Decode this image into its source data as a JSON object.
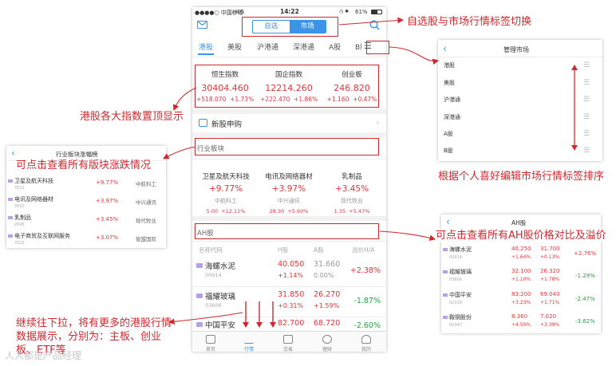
{
  "status_bar": {
    "carrier": "●●●●○ 中国移动",
    "network": "4G",
    "time": "14:22",
    "battery": "61%"
  },
  "segment": {
    "left": "自选",
    "right": "市场",
    "active": "市场"
  },
  "market_tabs": [
    "港股",
    "美股",
    "沪港通",
    "深港通",
    "A股",
    "B股"
  ],
  "active_market_tab": "港股",
  "indices": [
    {
      "name": "恒生指数",
      "value": "30404.460",
      "change": "+518.070",
      "pct": "+1.73%"
    },
    {
      "name": "国企指数",
      "value": "12214.260",
      "change": "+222.470",
      "pct": "+1.86%"
    },
    {
      "name": "创业板",
      "value": "246.820",
      "change": "+1.160",
      "pct": "+0.47%"
    }
  ],
  "ipo_label": "新股申购",
  "sector_title": "行业板块",
  "sectors": [
    {
      "name": "卫星及航天科技",
      "pct": "+9.77%",
      "leader": "中航科工",
      "price": "5.00",
      "leader_pct": "+12.11%"
    },
    {
      "name": "电讯及网络器材",
      "pct": "+3.97%",
      "leader": "中兴通讯",
      "price": "28.30",
      "leader_pct": "+5.60%"
    },
    {
      "name": "乳制品",
      "pct": "+3.45%",
      "leader": "现代牧业",
      "price": "1.35",
      "leader_pct": "+5.47%"
    }
  ],
  "ah_section": {
    "title": "AH股",
    "headers": [
      "名称代码",
      "H股",
      "A股",
      "溢价H/A"
    ],
    "rows": [
      {
        "name": "海螺水泥",
        "code": "00914",
        "h": "40.050",
        "h_chg": "+1.14%",
        "a": "31.660",
        "a_chg": "0.00%",
        "premium": "+2.38%"
      },
      {
        "name": "福耀玻璃",
        "code": "03606",
        "h": "31.850",
        "h_chg": "+0.31%",
        "a": "26.270",
        "a_chg": "+1.59%",
        "premium": "-1.87%"
      },
      {
        "name": "中国平安",
        "code": "02318",
        "h": "82.700",
        "h_chg": "",
        "a": "68.720",
        "a_chg": "",
        "premium": "-2.60%"
      }
    ]
  },
  "bottom_nav": [
    "首页",
    "行情",
    "交易",
    "理财",
    "我的"
  ],
  "active_bottom": "行情",
  "manage_panel": {
    "title": "管理市场",
    "items": [
      "港股",
      "美股",
      "沪港通",
      "深港通",
      "A股",
      "B股"
    ]
  },
  "sector_panel": {
    "title": "行业板块涨幅榜",
    "rows": [
      {
        "name": "卫星及航天科技",
        "code": "7012",
        "pct": "+9.77%",
        "leader": "中航科工"
      },
      {
        "name": "电讯及网络器材",
        "code": "3502",
        "pct": "+3.97%",
        "leader": "中兴通讯"
      },
      {
        "name": "乳制品",
        "code": "2045",
        "pct": "+3.45%",
        "leader": "现代牧业"
      },
      {
        "name": "电子商贸及互联网服务",
        "code": "7022",
        "pct": "+3.07%",
        "leader": "俊盟国际"
      }
    ]
  },
  "ah_panel": {
    "title": "AH股",
    "rows": [
      {
        "name": "海螺水泥",
        "code": "00914",
        "h": "40.250",
        "h_chg": "+1.64%",
        "a": "31.700",
        "a_chg": "+0.13%",
        "premium": "+2.76%"
      },
      {
        "name": "福耀玻璃",
        "code": "03606",
        "h": "32.100",
        "h_chg": "+1.10%",
        "a": "26.320",
        "a_chg": "+1.78%",
        "premium": "-1.29%"
      },
      {
        "name": "中国平安",
        "code": "02318",
        "h": "83.200",
        "h_chg": "+3.23%",
        "a": "69.040",
        "a_chg": "+1.71%",
        "premium": "-2.47%"
      },
      {
        "name": "鞍钢股份",
        "code": "00347",
        "h": "8.360",
        "h_chg": "+4.50%",
        "a": "7.020",
        "a_chg": "+3.39%",
        "premium": "-3.62%"
      }
    ]
  },
  "annotations": {
    "switch": "自选股与市场行情标签切换",
    "indices": "港股各大指数置顶显示",
    "sector": "可点击查看所有版块涨跌情况",
    "sort": "根据个人喜好编辑市场行情标签排序",
    "ah": "可点击查看所有AH股价格对比及溢价",
    "pull": "继续往下拉，将有更多的港股行情数据展示，分别为：主板、创业板、ETF等"
  },
  "watermark": "人人都是产品经理",
  "colors": {
    "accent": "#3a94e8",
    "up": "#e5333a",
    "down": "#22a33a",
    "annotation": "#d0282e"
  }
}
